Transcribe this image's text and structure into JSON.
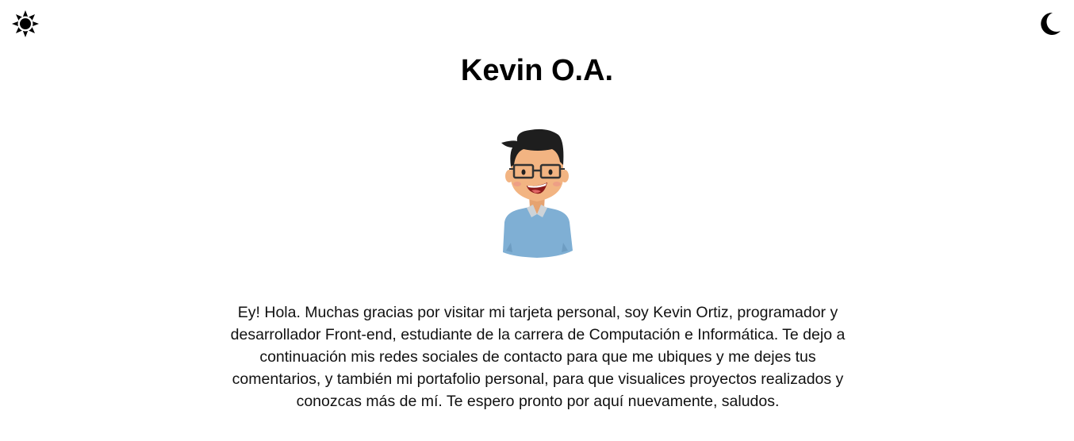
{
  "header": {
    "light_theme_icon": "sun-icon",
    "dark_theme_icon": "moon-icon"
  },
  "profile": {
    "name": "Kevin O.A.",
    "avatar_icon": "cartoon-avatar",
    "bio": "Ey! Hola. Muchas gracias por visitar mi tarjeta personal, soy Kevin Ortiz, programador y desarrollador Front-end, estudiante de la carrera de Computación e Informática. Te dejo a continuación mis redes sociales de contacto para que me ubiques y me dejes tus comentarios, y también mi portafolio personal, para que visualices proyectos realizados y conozcas más de mí. Te espero pronto por aquí nuevamente, saludos."
  },
  "colors": {
    "background": "#ffffff",
    "text": "#000000",
    "shirt": "#7fafd4",
    "skin": "#f2b482",
    "hair": "#1e1e1e"
  }
}
